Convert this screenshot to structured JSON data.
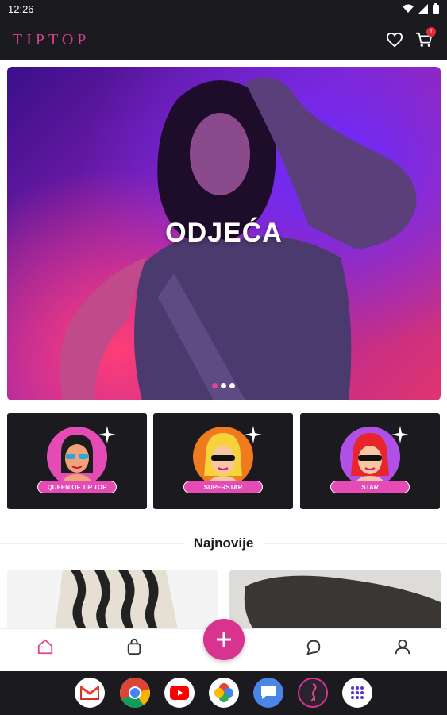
{
  "status_bar": {
    "time": "12:26"
  },
  "app_bar": {
    "logo": "TIPTOP",
    "cart_count": "1"
  },
  "hero": {
    "title": "ODJEĆA",
    "slide_count": 3,
    "active_slide": 0
  },
  "categories": [
    {
      "label": "QUEEN OF TIP TOP",
      "color": "#e44bb5"
    },
    {
      "label": "SUPERSTAR",
      "color": "#f07a1e"
    },
    {
      "label": "STAR",
      "color": "#b24fe6"
    }
  ],
  "section": {
    "title": "Najnovije"
  },
  "bottom_nav": [
    "home-icon",
    "bag-icon",
    "add-icon",
    "chat-icon",
    "profile-icon"
  ],
  "dock_apps": [
    "gmail-icon",
    "chrome-icon",
    "youtube-icon",
    "photos-icon",
    "messages-icon",
    "tiptop-icon",
    "app-drawer-icon"
  ],
  "colors": {
    "brand": "#d8338e",
    "dark": "#1b1a1f"
  }
}
